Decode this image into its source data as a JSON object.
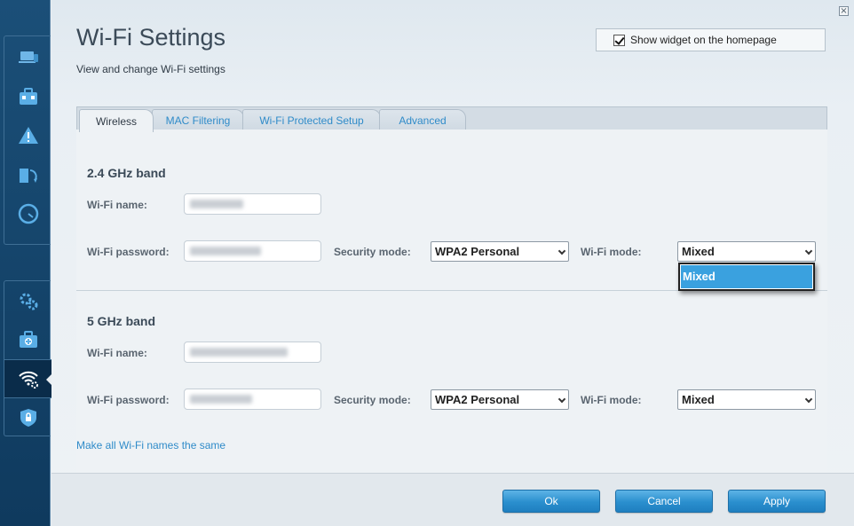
{
  "sidebar": {
    "icons": [
      "laptop-icon",
      "toolbox-icon",
      "warning-icon",
      "refresh-icon",
      "speedometer-icon",
      "gears-icon",
      "first-aid-icon",
      "wifi-settings-icon",
      "shield-lock-icon"
    ]
  },
  "header": {
    "title": "Wi-Fi Settings",
    "subtitle": "View and change Wi-Fi settings",
    "widget_checkbox_label": "Show widget on the homepage",
    "widget_checked": true
  },
  "tabs": [
    {
      "label": "Wireless",
      "active": true
    },
    {
      "label": "MAC Filtering",
      "active": false
    },
    {
      "label": "Wi-Fi Protected Setup",
      "active": false
    },
    {
      "label": "Advanced",
      "active": false
    }
  ],
  "bands": [
    {
      "title": "2.4 GHz band",
      "name_label": "Wi-Fi name:",
      "password_label": "Wi-Fi password:",
      "security_label": "Security mode:",
      "security_value": "WPA2 Personal",
      "mode_label": "Wi-Fi mode:",
      "mode_value": "Mixed"
    },
    {
      "title": "5 GHz band",
      "name_label": "Wi-Fi name:",
      "password_label": "Wi-Fi password:",
      "security_label": "Security mode:",
      "security_value": "WPA2 Personal",
      "mode_label": "Wi-Fi mode:",
      "mode_value": "Mixed"
    }
  ],
  "mode_dropdown": {
    "options": [
      "Mixed"
    ],
    "highlighted": "Mixed"
  },
  "links": {
    "make_same": "Make all Wi-Fi names the same"
  },
  "footer": {
    "ok": "Ok",
    "cancel": "Cancel",
    "apply": "Apply"
  },
  "colors": {
    "accent": "#2f8bc9",
    "sidebar": "#1b4f78",
    "highlight": "#3aa1df"
  }
}
